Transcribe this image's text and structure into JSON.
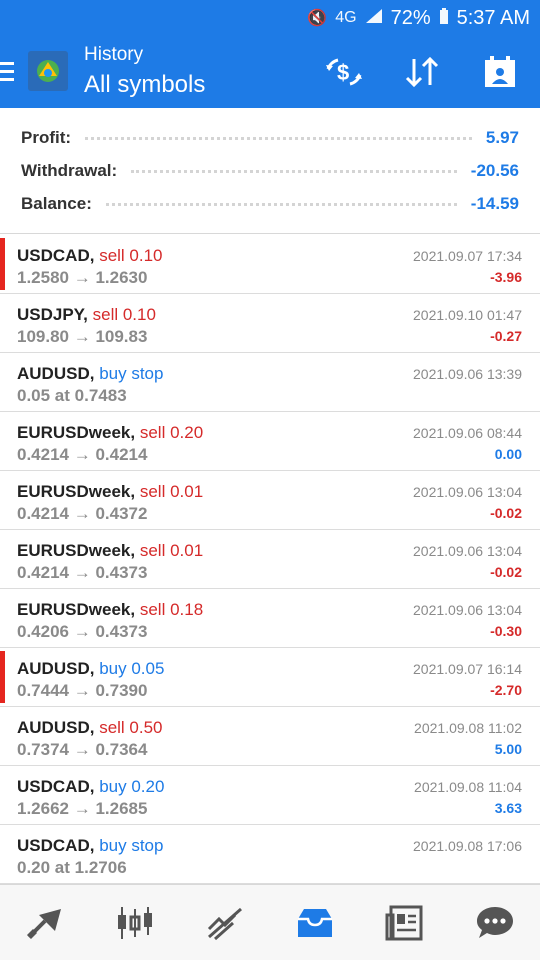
{
  "status_bar": {
    "battery": "72%",
    "time": "5:37 AM",
    "network": "4G"
  },
  "header": {
    "subtitle": "History",
    "title": "All symbols"
  },
  "summary": [
    {
      "label": "Profit:",
      "value": "5.97"
    },
    {
      "label": "Withdrawal:",
      "value": "-20.56"
    },
    {
      "label": "Balance:",
      "value": "-14.59"
    }
  ],
  "orders": [
    {
      "symbol": "USDCAD,",
      "action": "sell 0.10",
      "side": "sell",
      "prices": "1.2580 → 1.2630",
      "date": "2021.09.07 17:34",
      "pl": "-3.96",
      "flag": true
    },
    {
      "symbol": "USDJPY,",
      "action": "sell 0.10",
      "side": "sell",
      "prices": "109.80 → 109.83",
      "date": "2021.09.10 01:47",
      "pl": "-0.27",
      "flag": false
    },
    {
      "symbol": "AUDUSD,",
      "action": "buy stop",
      "side": "buy",
      "prices": "0.05 at 0.7483",
      "date": "2021.09.06 13:39",
      "pl": "",
      "flag": false
    },
    {
      "symbol": "EURUSDweek,",
      "action": "sell 0.20",
      "side": "sell",
      "prices": "0.4214 → 0.4214",
      "date": "2021.09.06 08:44",
      "pl": "0.00",
      "flag": false
    },
    {
      "symbol": "EURUSDweek,",
      "action": "sell 0.01",
      "side": "sell",
      "prices": "0.4214 → 0.4372",
      "date": "2021.09.06 13:04",
      "pl": "-0.02",
      "flag": false
    },
    {
      "symbol": "EURUSDweek,",
      "action": "sell 0.01",
      "side": "sell",
      "prices": "0.4214 → 0.4373",
      "date": "2021.09.06 13:04",
      "pl": "-0.02",
      "flag": false
    },
    {
      "symbol": "EURUSDweek,",
      "action": "sell 0.18",
      "side": "sell",
      "prices": "0.4206 → 0.4373",
      "date": "2021.09.06 13:04",
      "pl": "-0.30",
      "flag": false
    },
    {
      "symbol": "AUDUSD,",
      "action": "buy 0.05",
      "side": "buy",
      "prices": "0.7444 → 0.7390",
      "date": "2021.09.07 16:14",
      "pl": "-2.70",
      "flag": true
    },
    {
      "symbol": "AUDUSD,",
      "action": "sell 0.50",
      "side": "sell",
      "prices": "0.7374 → 0.7364",
      "date": "2021.09.08 11:02",
      "pl": "5.00",
      "flag": false
    },
    {
      "symbol": "USDCAD,",
      "action": "buy 0.20",
      "side": "buy",
      "prices": "1.2662 → 1.2685",
      "date": "2021.09.08 11:04",
      "pl": "3.63",
      "flag": false
    },
    {
      "symbol": "USDCAD,",
      "action": "buy stop",
      "side": "buy",
      "prices": "0.20 at 1.2706",
      "date": "2021.09.08 17:06",
      "pl": "",
      "flag": false
    }
  ],
  "colors": {
    "accent": "#1e7be6",
    "negative": "#d52a2a",
    "flag": "#e5261f"
  },
  "nav_icons": [
    "quotes-icon",
    "chart-icon",
    "trade-icon",
    "history-icon",
    "news-icon",
    "chat-icon"
  ]
}
